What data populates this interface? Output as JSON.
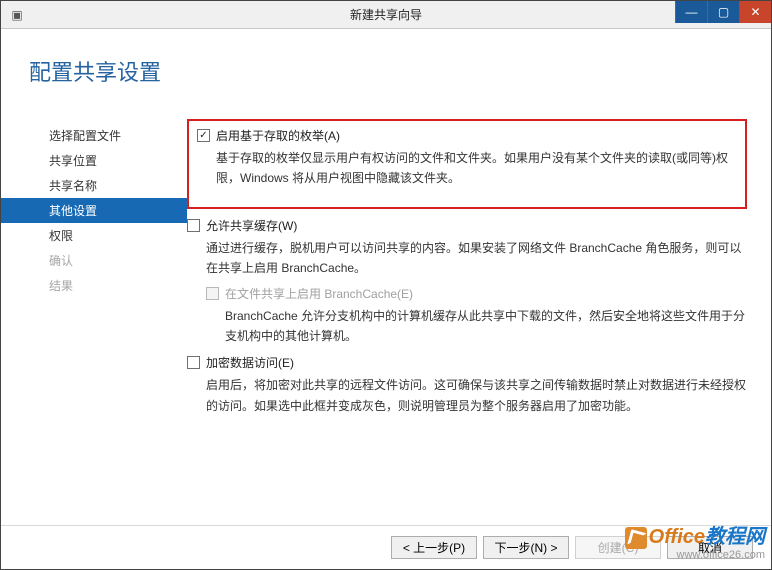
{
  "window": {
    "title": "新建共享向导"
  },
  "heading": "配置共享设置",
  "sidebar": {
    "items": [
      {
        "label": "选择配置文件",
        "state": "normal"
      },
      {
        "label": "共享位置",
        "state": "normal"
      },
      {
        "label": "共享名称",
        "state": "normal"
      },
      {
        "label": "其他设置",
        "state": "active"
      },
      {
        "label": "权限",
        "state": "normal"
      },
      {
        "label": "确认",
        "state": "disabled"
      },
      {
        "label": "结果",
        "state": "disabled"
      }
    ]
  },
  "options": {
    "abe": {
      "label": "启用基于存取的枚举(A)",
      "desc": "基于存取的枚举仅显示用户有权访问的文件和文件夹。如果用户没有某个文件夹的读取(或同等)权限，Windows 将从用户视图中隐藏该文件夹。"
    },
    "cache": {
      "label": "允许共享缓存(W)",
      "desc": "通过进行缓存，脱机用户可以访问共享的内容。如果安装了网络文件 BranchCache 角色服务，则可以在共享上启用 BranchCache。"
    },
    "branchcache": {
      "label": "在文件共享上启用 BranchCache(E)",
      "desc": "BranchCache 允许分支机构中的计算机缓存从此共享中下载的文件，然后安全地将这些文件用于分支机构中的其他计算机。"
    },
    "encrypt": {
      "label": "加密数据访问(E)",
      "desc": "启用后，将加密对此共享的远程文件访问。这可确保与该共享之间传输数据时禁止对数据进行未经授权的访问。如果选中此框并变成灰色，则说明管理员为整个服务器启用了加密功能。"
    }
  },
  "footer": {
    "prev": "< 上一步(P)",
    "next": "下一步(N) >",
    "create": "创建(C)",
    "cancel": "取消"
  },
  "watermark": {
    "brand_left": "Office",
    "brand_right": "教程网",
    "url": "www.office26.com"
  }
}
